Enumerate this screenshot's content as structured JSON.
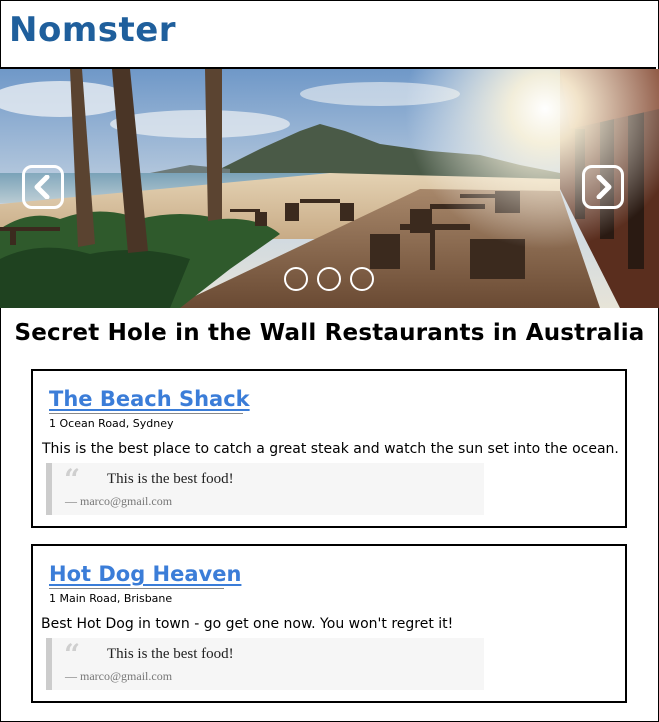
{
  "header": {
    "logo": "Nomster"
  },
  "carousel": {
    "image": "beach-restaurant-photo",
    "prev_icon": "chevron-left-icon",
    "next_icon": "chevron-right-icon",
    "slide_count": 3
  },
  "page": {
    "title": "Secret Hole in the Wall Restaurants in Australia"
  },
  "restaurants": [
    {
      "name": "The Beach Shack",
      "address": "1 Ocean Road, Sydney",
      "description": "This is the best place to catch a great steak and watch the sun set into the ocean.",
      "review": {
        "text": "This is the best food!",
        "author": "— marco@gmail.com"
      }
    },
    {
      "name": "Hot Dog Heaven",
      "address": "1 Main Road, Brisbane",
      "description": "Best Hot Dog in town - go get one now. You won't regret it!",
      "review": {
        "text": "This is the best food!",
        "author": "— marco@gmail.com"
      }
    }
  ],
  "colors": {
    "logo": "#1f5f9c",
    "link": "#3b7dd8",
    "quote_border": "#cccccc",
    "quote_bg": "#f6f6f6"
  }
}
